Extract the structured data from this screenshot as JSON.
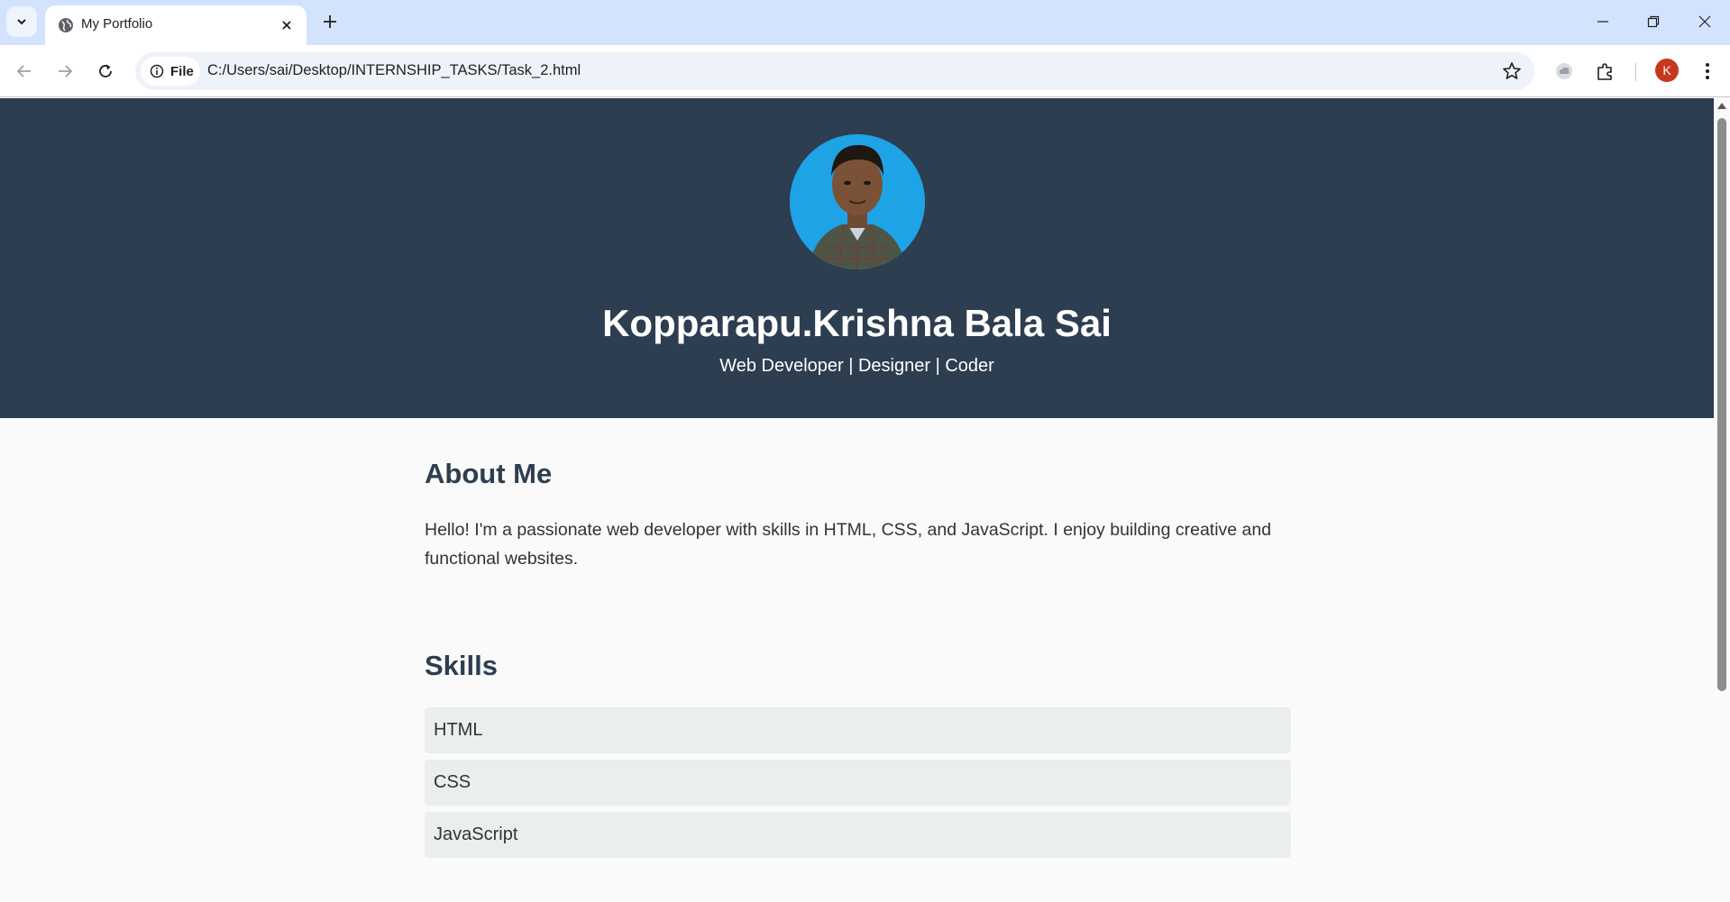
{
  "browser": {
    "tab_title": "My Portfolio",
    "chip_label": "File",
    "url": "C:/Users/sai/Desktop/INTERNSHIP_TASKS/Task_2.html",
    "profile_initial": "K"
  },
  "hero": {
    "name": "Kopparapu.Krishna Bala Sai",
    "tagline": "Web Developer | Designer | Coder"
  },
  "about": {
    "heading": "About Me",
    "text": "Hello! I'm a passionate web developer with skills in HTML, CSS, and JavaScript. I enjoy building creative and functional websites."
  },
  "skills": {
    "heading": "Skills",
    "items": [
      "HTML",
      "CSS",
      "JavaScript"
    ]
  },
  "colors": {
    "header_bg": "#2d3e50",
    "accent": "#1ea3e6",
    "skill_bg": "#ebeeef"
  }
}
